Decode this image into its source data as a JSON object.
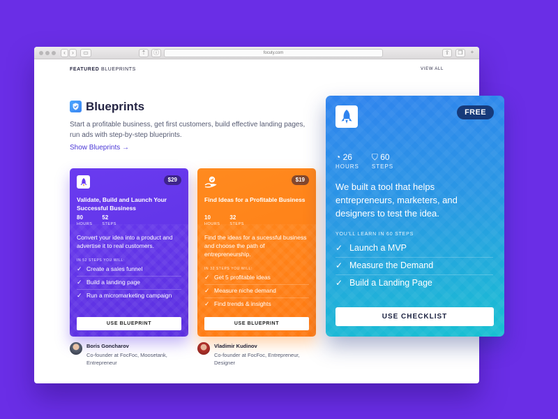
{
  "browser": {
    "url": "focuty.com"
  },
  "header": {
    "featured_label": "FEATURED",
    "blueprints_label": "BLUEPRINTS",
    "view_all": "VIEW ALL"
  },
  "section": {
    "title": "Blueprints",
    "description": "Start a profitable business, get first customers, build effective landing pages, run ads with step-by-step blueprints.",
    "show_link": "Show Blueprints →"
  },
  "cards": [
    {
      "price": "$29",
      "title": "Validate, Build and Launch Your Successful Business",
      "hours": "80",
      "hours_label": "HOURS",
      "steps_count": "52",
      "steps_label": "STEPS",
      "description": "Convert your idea into a product and advertise it to real customers.",
      "learn_heading": "IN 52 STEPS YOU WILL:",
      "steps": [
        "Create a sales funnel",
        "Build a landing page",
        "Run a micromarketing campaign"
      ],
      "button": "USE BLUEPRINT",
      "color": "#6a3bf0"
    },
    {
      "price": "$19",
      "title": "Find Ideas for a Profitable Business",
      "hours": "10",
      "hours_label": "HOURS",
      "steps_count": "32",
      "steps_label": "STEPS",
      "description": "Find the ideas for a sucessful business and choose the path of entrepreneurship.",
      "learn_heading": "IN 32 STEPS YOU WILL:",
      "steps": [
        "Get 5 profitable ideas",
        "Measure niche demand",
        "Find trends & insights"
      ],
      "button": "USE BLUEPRINT",
      "color": "#ff8a1f"
    }
  ],
  "authors": [
    {
      "name": "Boris Goncharov",
      "role": "Co-founder at FocFoc, Moosetank, Entrepreneur"
    },
    {
      "name": "Vladimir Kudinov",
      "role": "Co-founder at FocFoc, Entrepreneur, Designer"
    }
  ],
  "featured_card": {
    "badge": "FREE",
    "hours": "26",
    "hours_label": "HOURS",
    "steps_count": "60",
    "steps_label": "STEPS",
    "description": "We built a tool that helps entrepreneurs, marketers, and designers to test the idea.",
    "learn_heading": "YOU'LL LEARN IN 60 STEPS",
    "steps": [
      "Launch a MVP",
      "Measure the Demand",
      "Build a Landing Page"
    ],
    "button": "USE CHECKLIST"
  },
  "colors": {
    "background": "#6a2ee6",
    "purple_card": "#6a3bf0",
    "orange_card": "#ff8a1f",
    "featured_badge": "#163a7a"
  },
  "icons": [
    "rocket-icon",
    "shield-check-icon",
    "hand-check-icon",
    "clock-icon",
    "check-icon"
  ]
}
